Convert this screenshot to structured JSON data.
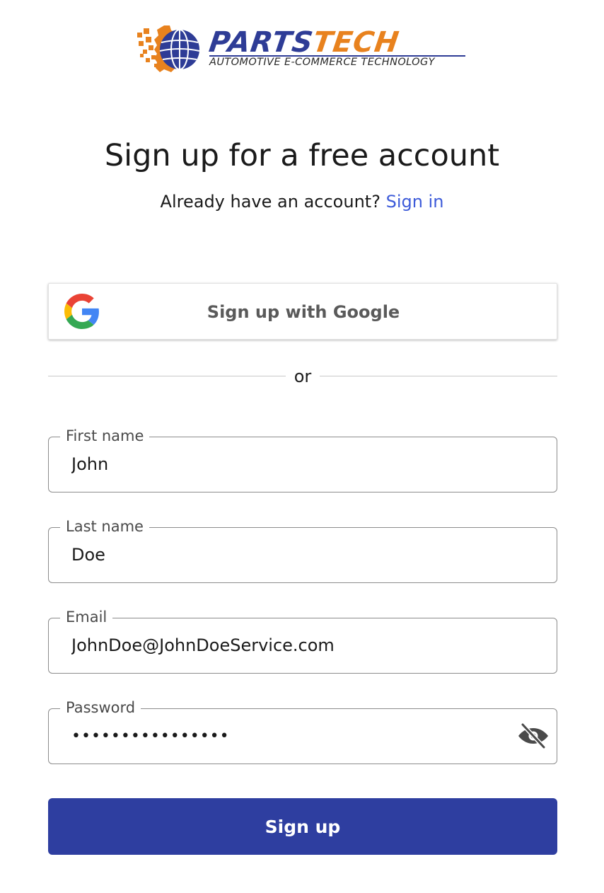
{
  "brand": {
    "name_part1": "PARTS",
    "name_part2": "TECH",
    "tagline": "AUTOMOTIVE E-COMMERCE TECHNOLOGY",
    "primary_color": "#2e3c96",
    "accent_color": "#e8821e"
  },
  "heading": {
    "title": "Sign up for a free account",
    "prompt": "Already have an account?",
    "signin_link": "Sign in",
    "link_color": "#3d5bd9"
  },
  "google": {
    "label": "Sign up with Google",
    "icon": "google-g-icon"
  },
  "divider": {
    "text": "or"
  },
  "form": {
    "first_name": {
      "label": "First name",
      "value": "John"
    },
    "last_name": {
      "label": "Last name",
      "value": "Doe"
    },
    "email": {
      "label": "Email",
      "value": "JohnDoe@JohnDoeService.com"
    },
    "password": {
      "label": "Password",
      "value": "••••••••••••••••",
      "toggle_icon": "eye-off-icon"
    }
  },
  "submit": {
    "label": "Sign up",
    "color": "#2e3ea0"
  }
}
